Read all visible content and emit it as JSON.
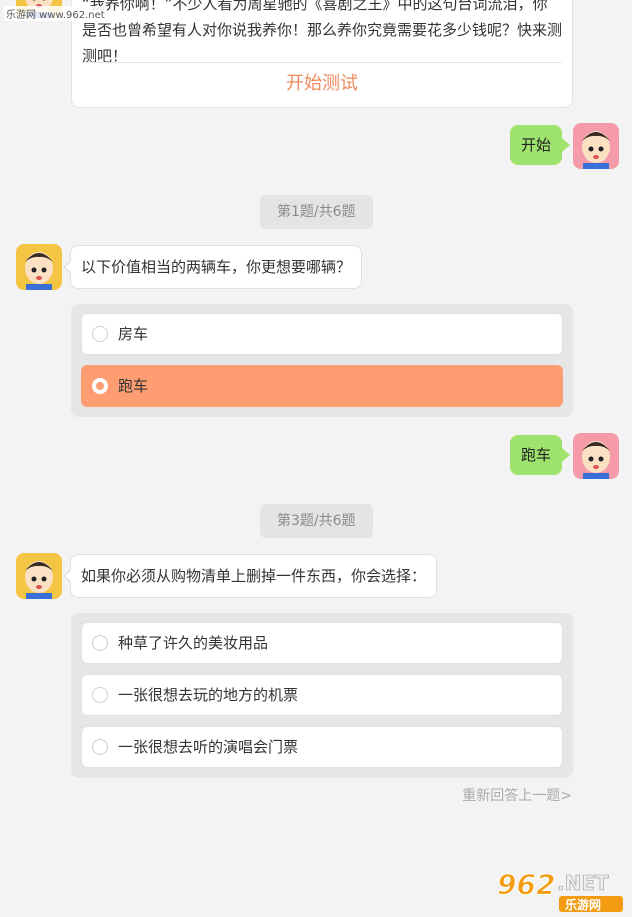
{
  "watermark": {
    "site": "乐游网 www.962.net",
    "logo_number": "962",
    "logo_net": ".NET",
    "logo_cn": "乐游网"
  },
  "intro": {
    "text_line1": "“我养你啊！”不少人看为周星驰的《喜剧之王》中的这句台词流泪，你",
    "text_line2": "是否也曾希望有人对你说我养你！那么养你究竟需要花多少钱呢？快来测",
    "text_line3": "测吧！",
    "start_label": "开始测试"
  },
  "reply_start": "开始",
  "question1": {
    "counter": "第1题/共6题",
    "text": "以下价值相当的两辆车，你更想要哪辆？",
    "options": [
      "房车",
      "跑车"
    ],
    "selected_index": 1
  },
  "reply_q1": "跑车",
  "question3": {
    "counter": "第3题/共6题",
    "text": "如果你必须从购物清单上删掉一件东西，你会选择：",
    "options": [
      "种草了许久的美妆用品",
      "一张很想去玩的地方的机票",
      "一张很想去听的演唱会门票"
    ]
  },
  "redo_label": "重新回答上一题>",
  "colors": {
    "accent": "#f08a5d",
    "selected_option": "#ff9d72",
    "reply_bubble": "#9ee36e",
    "counter_bg": "#e4e4e4"
  },
  "icons": {
    "bot_avatar": "boy-cartoon-avatar",
    "user_avatar": "boy-cartoon-avatar-pink"
  }
}
